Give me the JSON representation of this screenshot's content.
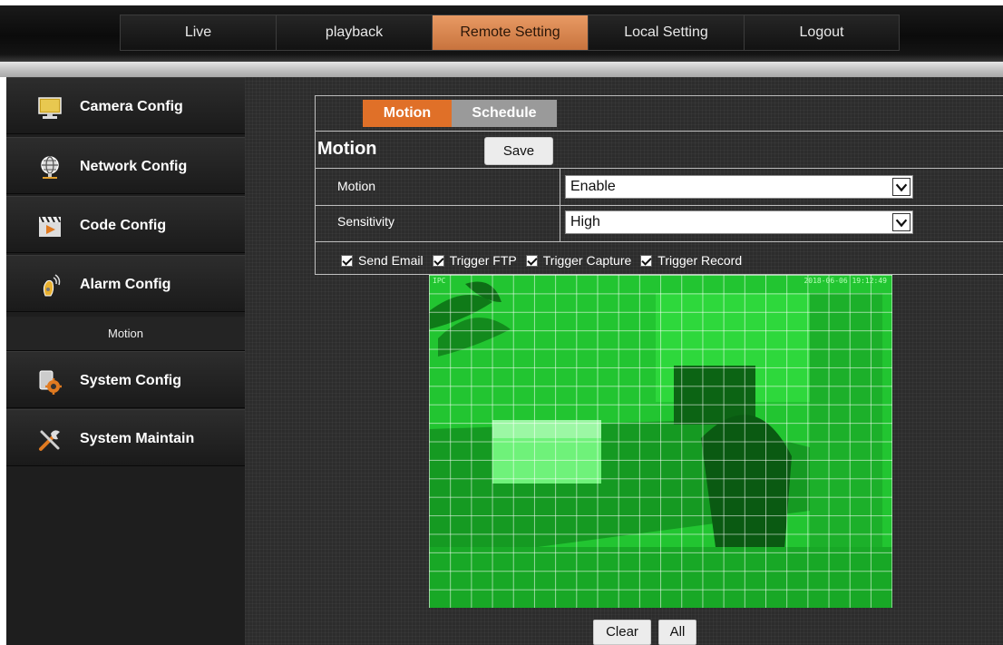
{
  "nav": {
    "items": [
      {
        "label": "Live",
        "active": false
      },
      {
        "label": "playback",
        "active": false
      },
      {
        "label": "Remote Setting",
        "active": true
      },
      {
        "label": "Local Setting",
        "active": false
      },
      {
        "label": "Logout",
        "active": false
      }
    ]
  },
  "sidebar": {
    "items": [
      {
        "label": "Camera Config",
        "icon": "monitor-icon"
      },
      {
        "label": "Network Config",
        "icon": "globe-network-icon"
      },
      {
        "label": "Code Config",
        "icon": "clapper-icon"
      },
      {
        "label": "Alarm Config",
        "icon": "alarm-bell-icon"
      },
      {
        "label": "System Config",
        "icon": "gear-icon"
      },
      {
        "label": "System Maintain",
        "icon": "tools-icon"
      }
    ],
    "sub_item": "Motion"
  },
  "tabs": [
    {
      "label": "Motion",
      "active": true
    },
    {
      "label": "Schedule",
      "active": false
    }
  ],
  "panel": {
    "title": "Motion",
    "save_label": "Save",
    "motion_label": "Motion",
    "motion_value": "Enable",
    "sensitivity_label": "Sensitivity",
    "sensitivity_value": "High",
    "checks": [
      {
        "label": "Send Email",
        "checked": true
      },
      {
        "label": "Trigger FTP",
        "checked": true
      },
      {
        "label": "Trigger Capture",
        "checked": true
      },
      {
        "label": "Trigger Record",
        "checked": true
      }
    ]
  },
  "video": {
    "osd_left": "IPC",
    "osd_right": "2018-06-06 19:12:49"
  },
  "buttons": {
    "clear_label": "Clear",
    "all_label": "All"
  },
  "colors": {
    "accent": "#e07028",
    "motion_overlay": "#1fc82e"
  }
}
